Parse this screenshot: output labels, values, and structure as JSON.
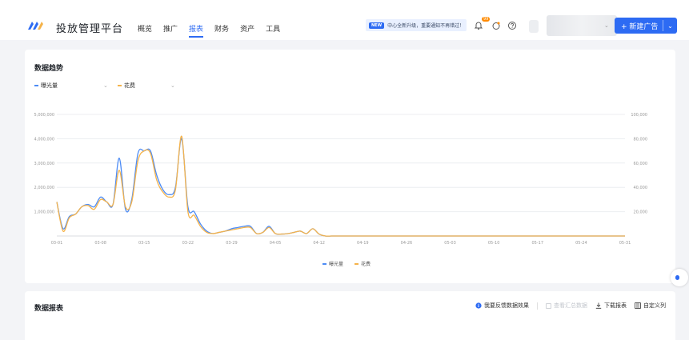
{
  "header": {
    "brand": "投放管理平台",
    "nav": [
      "概览",
      "推广",
      "报表",
      "财务",
      "资产",
      "工具"
    ],
    "active_nav": "报表",
    "notice_badge": "NEW",
    "notice_text": "中心全新升级，重要通知不再错过！",
    "notif_count": "99",
    "new_button": "+ 新建广告"
  },
  "trend": {
    "title": "数据趋势",
    "selector1": "曝光量",
    "selector2": "花费"
  },
  "report": {
    "title": "数据报表",
    "tool_feedback": "我要反馈数据效果",
    "tool_summary": "查看汇总数据",
    "tool_download": "下载报表",
    "tool_columns": "自定义列"
  },
  "colors": {
    "accent": "#2d6bf3",
    "series_exposure": "#4c8bf5",
    "series_cost": "#f5b34a"
  },
  "icons": [
    "logo-icon",
    "bell-icon",
    "gift-icon",
    "help-icon",
    "chevron-down-icon",
    "info-icon",
    "download-icon",
    "columns-icon"
  ],
  "chart_data": {
    "type": "line",
    "x": [
      "03-01",
      "03-02",
      "03-03",
      "03-04",
      "03-05",
      "03-06",
      "03-07",
      "03-08",
      "03-09",
      "03-10",
      "03-11",
      "03-12",
      "03-13",
      "03-14",
      "03-15",
      "03-16",
      "03-17",
      "03-18",
      "03-19",
      "03-20",
      "03-21",
      "03-22",
      "03-23",
      "03-24",
      "03-25",
      "03-26",
      "03-27",
      "03-28",
      "03-29",
      "03-30",
      "03-31",
      "04-01",
      "04-02",
      "04-03",
      "04-04",
      "04-05",
      "04-06",
      "04-07",
      "04-08",
      "04-09",
      "04-10",
      "04-11",
      "04-12",
      "04-13",
      "04-14",
      "04-15",
      "04-16",
      "04-17",
      "04-18",
      "04-19",
      "04-20",
      "04-21",
      "04-22",
      "04-23",
      "04-24",
      "04-25",
      "04-26",
      "04-27",
      "04-28",
      "04-29",
      "04-30",
      "05-01",
      "05-02",
      "05-03",
      "05-04",
      "05-05",
      "05-06",
      "05-07",
      "05-08",
      "05-09",
      "05-10",
      "05-11",
      "05-12",
      "05-13",
      "05-14",
      "05-15",
      "05-16",
      "05-17",
      "05-18",
      "05-19",
      "05-20",
      "05-21",
      "05-22",
      "05-23",
      "05-24",
      "05-25",
      "05-26",
      "05-27",
      "05-28",
      "05-29",
      "05-30",
      "05-31"
    ],
    "x_ticks": [
      "03-01",
      "03-08",
      "03-15",
      "03-22",
      "03-29",
      "04-05",
      "04-12",
      "04-19",
      "04-26",
      "05-03",
      "05-10",
      "05-17",
      "05-24",
      "05-31"
    ],
    "y_left_ticks": [
      "1,000,000",
      "2,000,000",
      "3,000,000",
      "4,000,000",
      "5,000,000"
    ],
    "y_right_ticks": [
      "20,000",
      "40,000",
      "60,000",
      "80,000",
      "100,000"
    ],
    "ylim_left": [
      0,
      5000000
    ],
    "ylim_right": [
      0,
      100000
    ],
    "series": [
      {
        "name": "曝光量",
        "axis": "left",
        "values": [
          1400000,
          300000,
          800000,
          900000,
          1200000,
          1300000,
          1200000,
          1600000,
          1400000,
          1300000,
          3200000,
          1100000,
          1500000,
          3400000,
          3500000,
          3500000,
          2500000,
          1900000,
          1700000,
          2000000,
          4000000,
          1200000,
          1000000,
          500000,
          200000,
          100000,
          150000,
          200000,
          300000,
          350000,
          400000,
          400000,
          100000,
          150000,
          400000,
          100000,
          80000,
          100000,
          150000,
          200000,
          100000,
          300000,
          80000,
          0,
          0,
          0,
          0,
          0,
          0,
          0,
          0,
          0,
          0,
          0,
          0,
          0,
          0,
          0,
          0,
          0,
          0,
          0,
          0,
          0,
          0,
          0,
          0,
          0,
          0,
          0,
          0,
          0,
          0,
          0,
          0,
          0,
          0,
          0,
          0,
          0,
          0,
          0,
          0,
          0,
          0,
          0,
          0,
          0,
          0,
          0,
          0,
          0
        ]
      },
      {
        "name": "花费",
        "axis": "right",
        "values": [
          28000,
          4000,
          15000,
          18000,
          24000,
          25000,
          22000,
          30000,
          28000,
          26000,
          54000,
          24000,
          28000,
          62000,
          70000,
          68000,
          46000,
          36000,
          32000,
          38000,
          82000,
          20000,
          17000,
          8000,
          3000,
          2000,
          3000,
          4000,
          5000,
          6000,
          7000,
          7000,
          2000,
          3000,
          7000,
          2000,
          1600,
          2000,
          3000,
          4000,
          2000,
          6000,
          1600,
          0,
          0,
          0,
          0,
          0,
          0,
          0,
          0,
          0,
          0,
          0,
          0,
          0,
          0,
          0,
          0,
          0,
          0,
          0,
          0,
          0,
          0,
          0,
          0,
          0,
          0,
          0,
          0,
          0,
          0,
          0,
          0,
          0,
          0,
          0,
          0,
          0,
          0,
          0,
          0,
          0,
          0,
          0,
          0,
          0,
          0,
          0,
          0,
          0
        ]
      }
    ],
    "grid": true,
    "legend_position": "bottom"
  }
}
